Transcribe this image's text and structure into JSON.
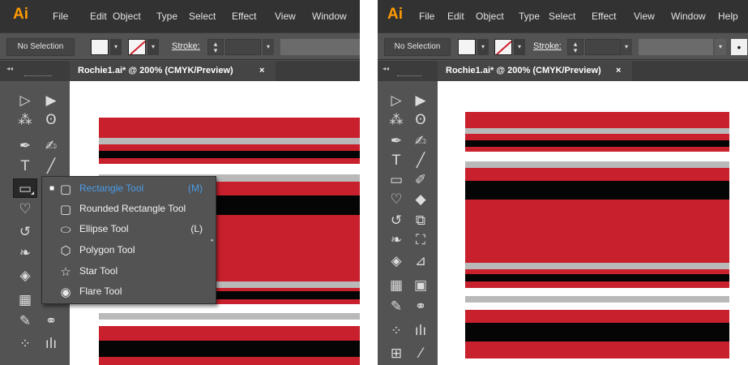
{
  "left": {
    "app_logo": "Ai",
    "menu": [
      "File",
      "Edit",
      "Object",
      "Type",
      "Select",
      "Effect",
      "View",
      "Window"
    ],
    "control_bar": {
      "selection": "No Selection",
      "stroke_label": "Stroke:"
    },
    "document_tab": {
      "title": "Rochie1.ai* @ 200% (CMYK/Preview)",
      "close": "×"
    },
    "flyout": {
      "items": [
        {
          "label": "Rectangle Tool",
          "shortcut": "(M)",
          "icon": "rectangle-icon",
          "active": true
        },
        {
          "label": "Rounded Rectangle Tool",
          "shortcut": "",
          "icon": "rounded-rectangle-icon",
          "active": false
        },
        {
          "label": "Ellipse Tool",
          "shortcut": "(L)",
          "icon": "ellipse-icon",
          "active": false
        },
        {
          "label": "Polygon Tool",
          "shortcut": "",
          "icon": "polygon-icon",
          "active": false
        },
        {
          "label": "Star Tool",
          "shortcut": "",
          "icon": "star-icon",
          "active": false
        },
        {
          "label": "Flare Tool",
          "shortcut": "",
          "icon": "flare-icon",
          "active": false
        }
      ]
    }
  },
  "right": {
    "app_logo": "Ai",
    "menu": [
      "File",
      "Edit",
      "Object",
      "Type",
      "Select",
      "Effect",
      "View",
      "Window",
      "Help"
    ],
    "control_bar": {
      "selection": "No Selection",
      "stroke_label": "Stroke:"
    },
    "document_tab": {
      "title": "Rochie1.ai* @ 200% (CMYK/Preview)",
      "close": "×"
    }
  },
  "icons": {
    "selection": "selection-tool-icon",
    "direct_selection": "direct-selection-tool-icon",
    "magic_wand": "magic-wand-tool-icon",
    "lasso": "lasso-tool-icon",
    "pen": "pen-tool-icon",
    "curvature": "curvature-tool-icon",
    "type": "type-tool-icon",
    "line": "line-segment-tool-icon",
    "rectangle": "rectangle-tool-icon",
    "paintbrush": "paintbrush-tool-icon",
    "shaper": "shaper-tool-icon",
    "eraser": "eraser-tool-icon",
    "rotate": "rotate-tool-icon",
    "scale": "scale-tool-icon",
    "warp": "warp-tool-icon",
    "free_transform": "free-transform-tool-icon",
    "shape_builder": "shape-builder-tool-icon",
    "perspective_grid": "perspective-grid-tool-icon",
    "mesh": "mesh-tool-icon",
    "gradient": "gradient-tool-icon",
    "eyedropper": "eyedropper-tool-icon",
    "blend": "blend-tool-icon",
    "symbol_sprayer": "symbol-sprayer-tool-icon",
    "column_graph": "column-graph-tool-icon",
    "artboard": "artboard-tool-icon",
    "slice": "slice-tool-icon"
  },
  "colors": {
    "app_logo": "#ff9a00",
    "menubar": "#323232",
    "ui_panel": "#535353",
    "flyout_highlight": "#4a9be8",
    "stripe_red": "#c8202c",
    "stripe_black": "#050505",
    "stripe_grey": "#b9b9b9",
    "stripe_white": "#ffffff",
    "canvas_bg": "#ffffff"
  }
}
